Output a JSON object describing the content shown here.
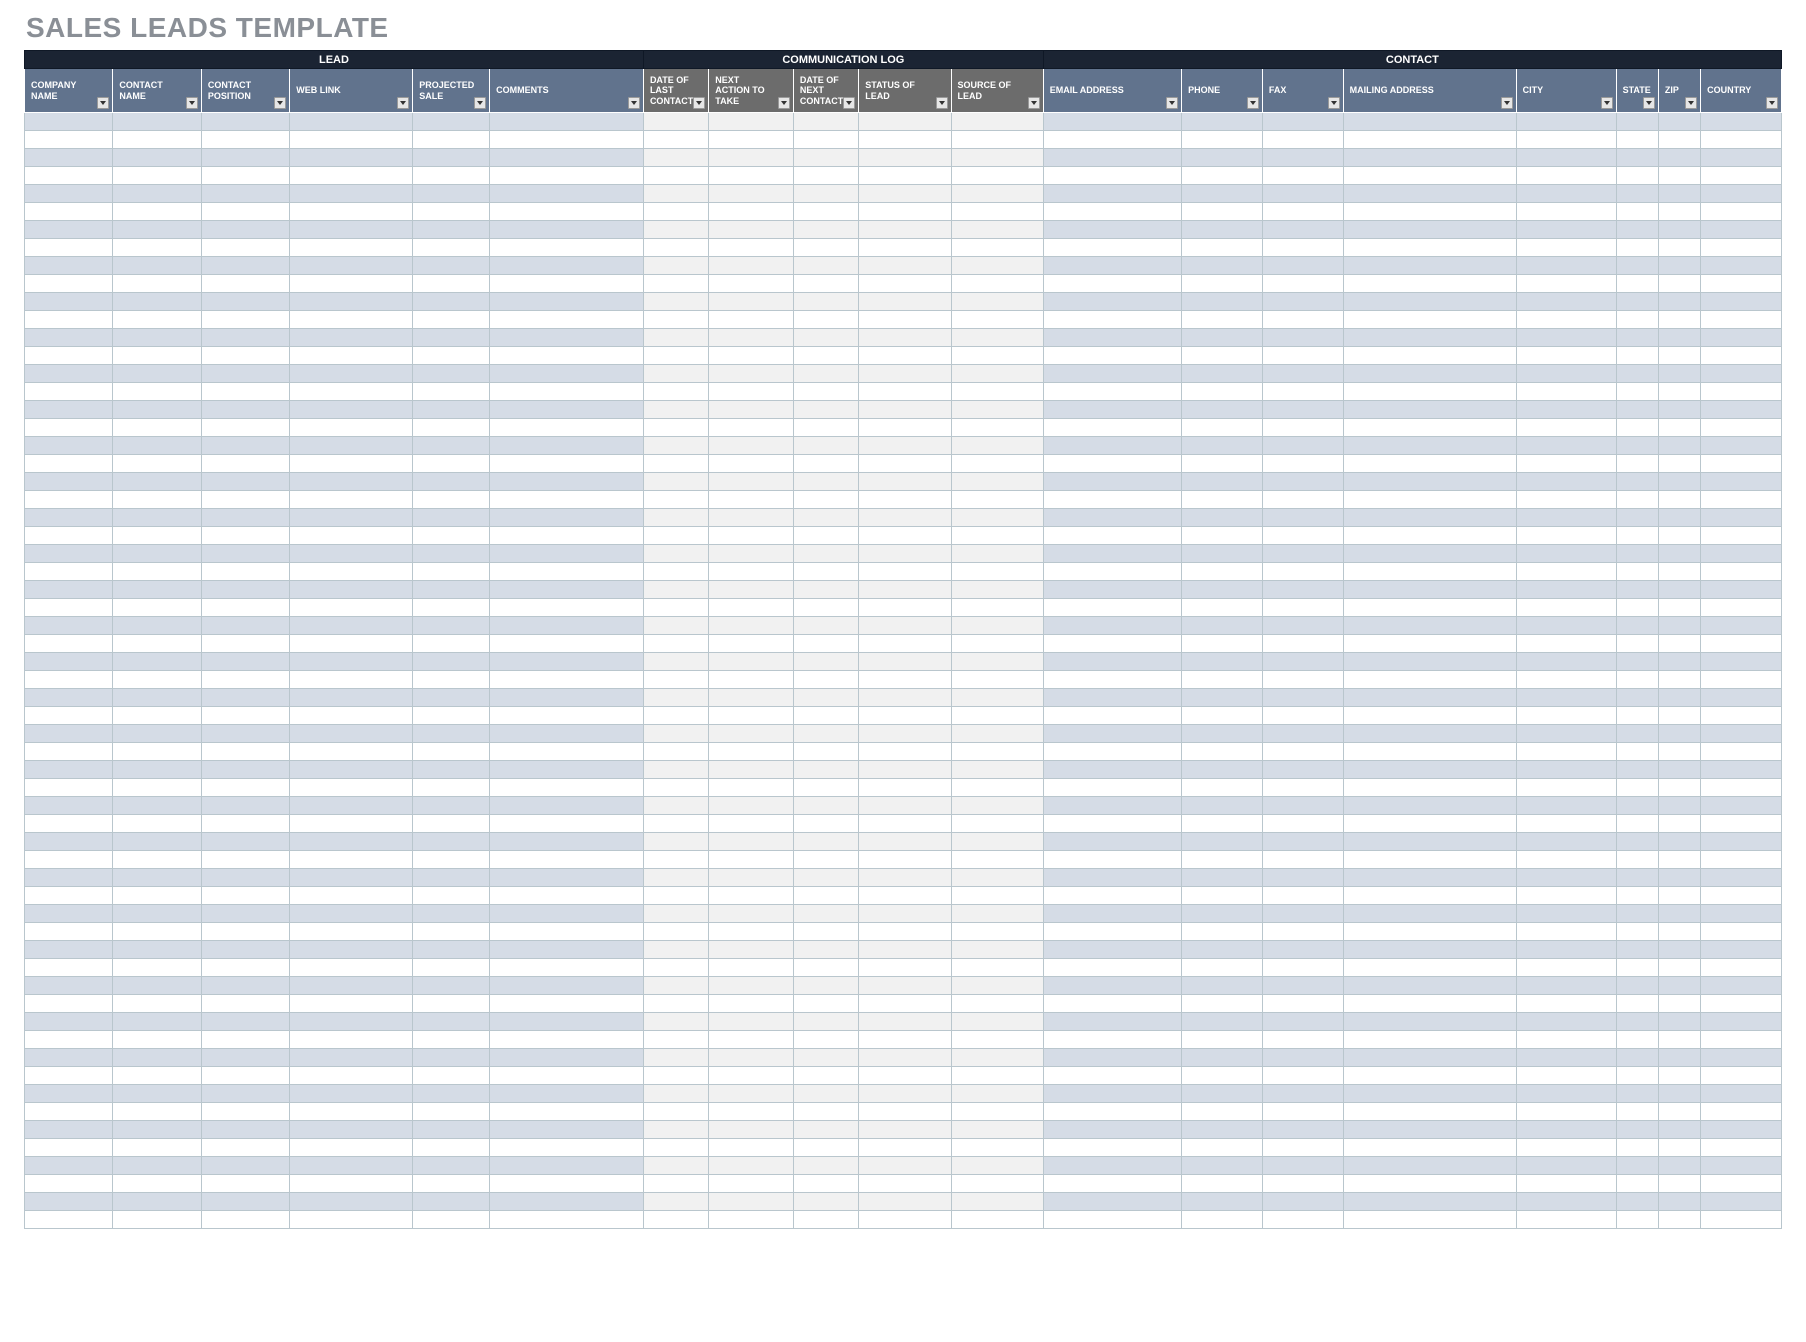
{
  "title": "SALES LEADS TEMPLATE",
  "sections": [
    {
      "key": "lead",
      "label": "LEAD",
      "span": 6
    },
    {
      "key": "comm",
      "label": "COMMUNICATION LOG",
      "span": 5
    },
    {
      "key": "contact",
      "label": "CONTACT",
      "span": 8
    }
  ],
  "columns": [
    {
      "key": "company_name",
      "label": "COMPANY NAME",
      "section": "lead"
    },
    {
      "key": "contact_name",
      "label": "CONTACT NAME",
      "section": "lead"
    },
    {
      "key": "contact_position",
      "label": "CONTACT POSITION",
      "section": "lead"
    },
    {
      "key": "web_link",
      "label": "WEB LINK",
      "section": "lead"
    },
    {
      "key": "projected_sale",
      "label": "PROJECTED SALE",
      "section": "lead"
    },
    {
      "key": "comments",
      "label": "COMMENTS",
      "section": "lead"
    },
    {
      "key": "date_last",
      "label": "DATE OF LAST CONTACT",
      "section": "comm"
    },
    {
      "key": "next_action",
      "label": "NEXT ACTION TO TAKE",
      "section": "comm"
    },
    {
      "key": "date_next",
      "label": "DATE OF NEXT CONTACT",
      "section": "comm"
    },
    {
      "key": "status",
      "label": "STATUS OF LEAD",
      "section": "comm"
    },
    {
      "key": "source",
      "label": "SOURCE OF LEAD",
      "section": "comm"
    },
    {
      "key": "email",
      "label": "EMAIL ADDRESS",
      "section": "contact"
    },
    {
      "key": "phone",
      "label": "PHONE",
      "section": "contact"
    },
    {
      "key": "fax",
      "label": "FAX",
      "section": "contact"
    },
    {
      "key": "mailing_address",
      "label": "MAILING ADDRESS",
      "section": "contact"
    },
    {
      "key": "city",
      "label": "CITY",
      "section": "contact"
    },
    {
      "key": "state",
      "label": "STATE",
      "section": "contact"
    },
    {
      "key": "zip",
      "label": "ZIP",
      "section": "contact"
    },
    {
      "key": "country",
      "label": "COUNTRY",
      "section": "contact"
    }
  ],
  "row_count": 62,
  "rows": []
}
